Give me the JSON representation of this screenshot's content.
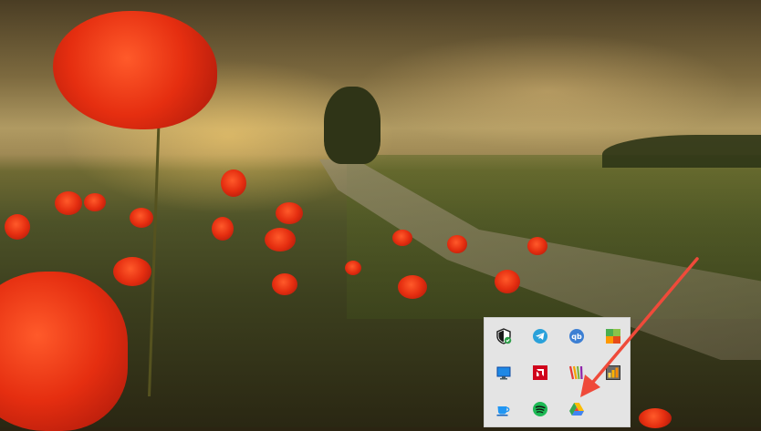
{
  "wallpaper": {
    "description_colors": {
      "sky": "#b09a62",
      "field": "#4f5a23",
      "poppy": "#e52e10"
    }
  },
  "tray": {
    "icons": [
      {
        "name": "windows-security-icon",
        "color": "#1a1a1a"
      },
      {
        "name": "telegram-icon",
        "color": "#2aa1da"
      },
      {
        "name": "qbittorrent-icon",
        "color": "#3c7fd3"
      },
      {
        "name": "app-tile-icon",
        "color": "#4caf50"
      },
      {
        "name": "monitor-icon",
        "color": "#1e88e5"
      },
      {
        "name": "amd-software-icon",
        "color": "#d0021b"
      },
      {
        "name": "color-stripes-icon",
        "color": "#f4a300"
      },
      {
        "name": "network-tile-icon",
        "color": "#6a6a6a"
      },
      {
        "name": "cup-icon",
        "color": "#2196f3"
      },
      {
        "name": "spotify-icon",
        "color": "#1db954"
      },
      {
        "name": "google-drive-icon",
        "color": "#34a853"
      }
    ]
  },
  "annotation": {
    "arrow_color": "#ef4a3a"
  }
}
